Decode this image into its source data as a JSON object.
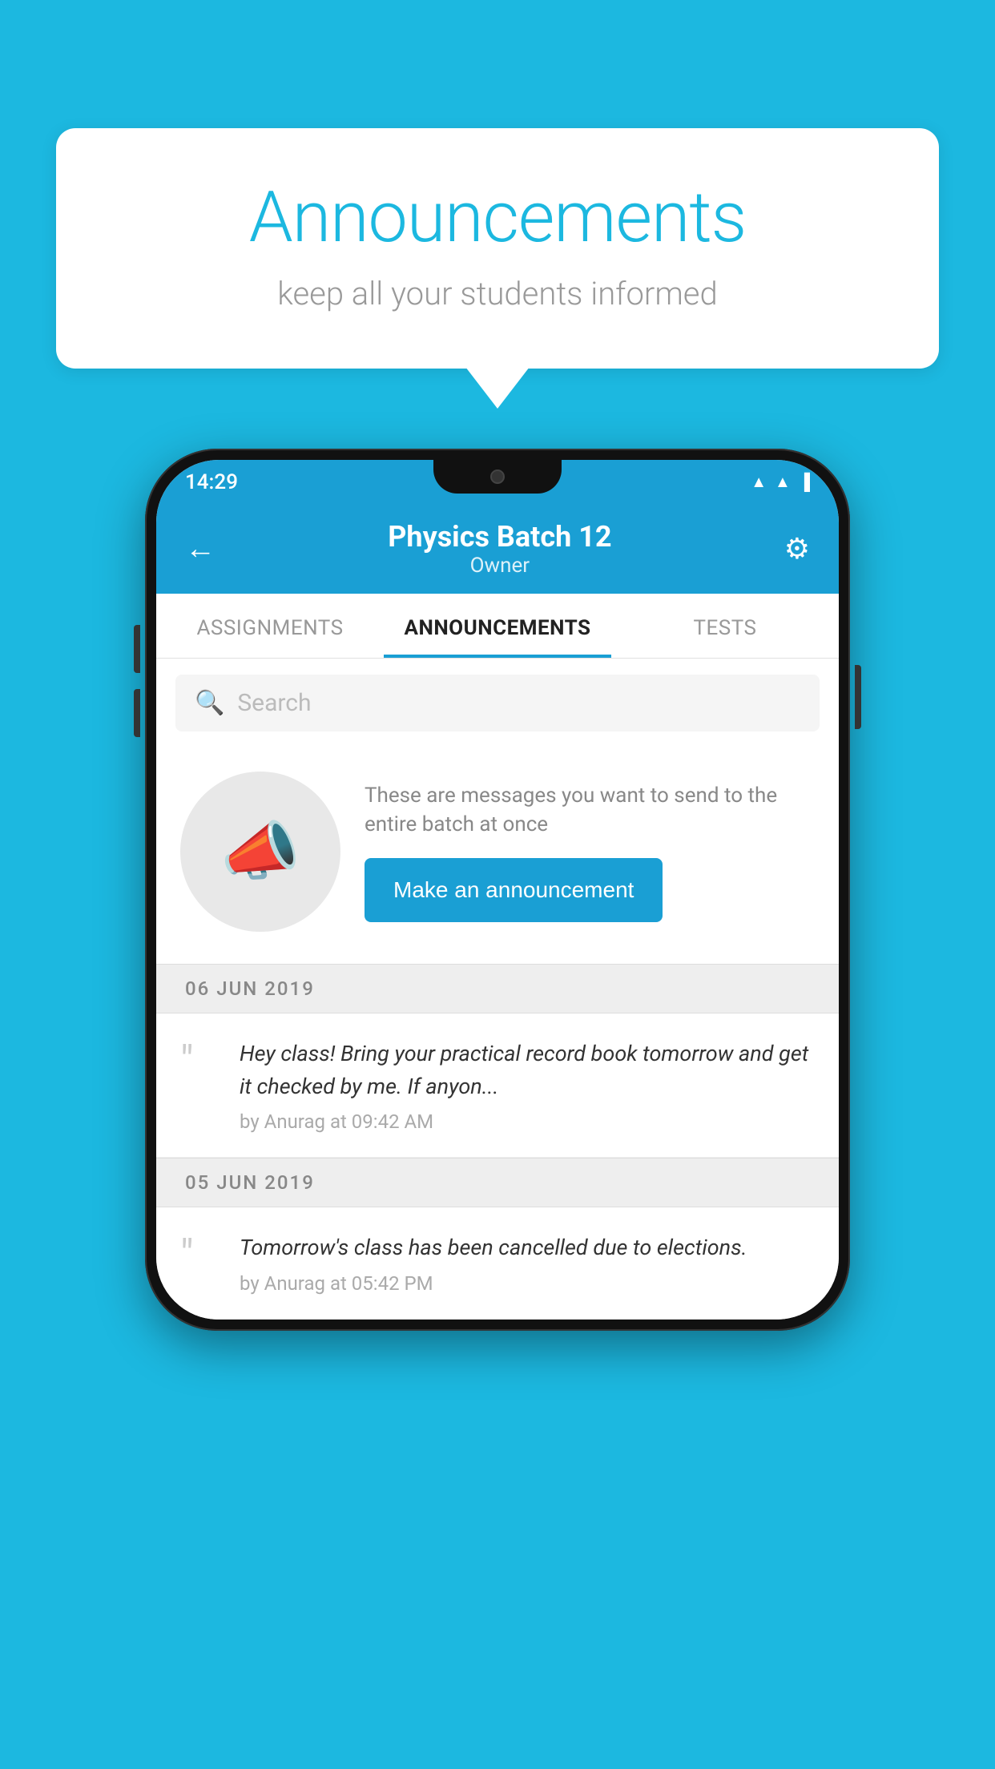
{
  "page": {
    "background_color": "#1cb8e0"
  },
  "speech_bubble": {
    "title": "Announcements",
    "subtitle": "keep all your students informed"
  },
  "phone": {
    "status_bar": {
      "time": "14:29",
      "icons": [
        "wifi",
        "signal",
        "battery"
      ]
    },
    "app_bar": {
      "title": "Physics Batch 12",
      "subtitle": "Owner",
      "back_icon": "←",
      "settings_icon": "⚙"
    },
    "tabs": [
      {
        "label": "ASSIGNMENTS",
        "active": false
      },
      {
        "label": "ANNOUNCEMENTS",
        "active": true
      },
      {
        "label": "TESTS",
        "active": false
      }
    ],
    "search": {
      "placeholder": "Search"
    },
    "cta": {
      "description": "These are messages you want to send to the entire batch at once",
      "button_label": "Make an announcement"
    },
    "announcements": [
      {
        "date": "06  JUN  2019",
        "text": "Hey class! Bring your practical record book tomorrow and get it checked by me. If anyon...",
        "meta": "by Anurag at 09:42 AM"
      },
      {
        "date": "05  JUN  2019",
        "text": "Tomorrow's class has been cancelled due to elections.",
        "meta": "by Anurag at 05:42 PM"
      }
    ]
  }
}
